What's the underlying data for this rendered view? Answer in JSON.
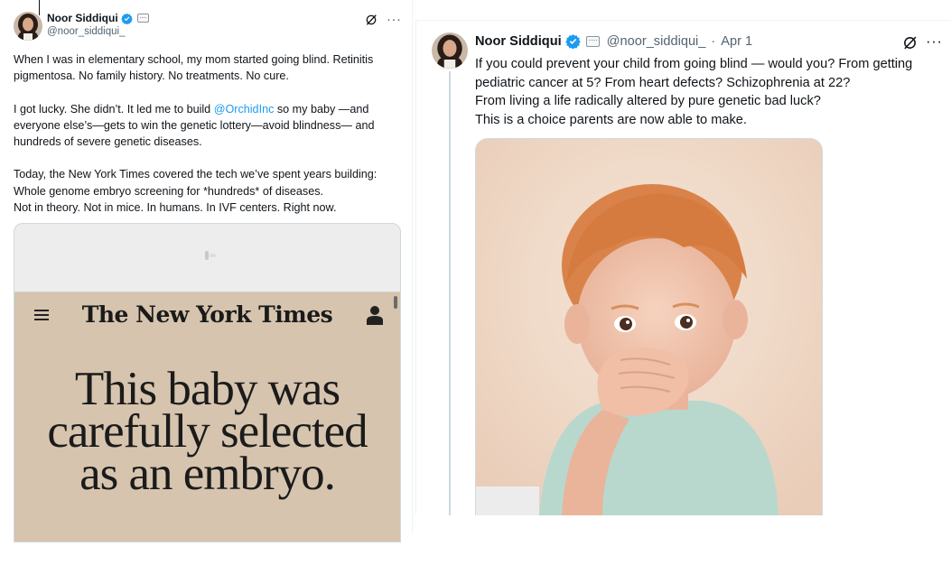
{
  "left_tweet": {
    "author_name": "Noor Siddiqui",
    "handle": "@noor_siddiqui_",
    "paragraphs": [
      [
        "When I was in elementary school, my mom started going blind. Retinitis pigmentosa. No family history. No treatments. No cure."
      ],
      [
        "I got lucky. She didn’t. It led me to build ",
        "@OrchidInc",
        " so my baby —and everyone else’s—gets to win the genetic lottery—avoid blindness— and hundreds of severe genetic diseases."
      ],
      [
        "Today, the New York Times covered the tech we’ve spent years building:",
        "Whole genome embryo screening for *hundreds* of diseases.",
        "Not in theory. Not in mice. In humans. In IVF centers. Right now."
      ]
    ],
    "media": {
      "masthead": "The New York Times",
      "headline_lines": [
        "This baby was",
        "carefully selected",
        "as an embryo."
      ]
    },
    "icons": {
      "verified": "verified-badge-icon",
      "grok": "grok-icon",
      "more": "more-options-icon",
      "menu": "hamburger-menu-icon",
      "user": "account-icon"
    }
  },
  "right_tweet": {
    "author_name": "Noor Siddiqui",
    "handle": "@noor_siddiqui_",
    "separator": "·",
    "date": "Apr 1",
    "lines": [
      "If you could prevent your child from going blind — would you? From getting",
      "pediatric cancer at 5? From heart defects? Schizophrenia at 22?",
      "From living a life radically altered by pure genetic bad luck?",
      "This is a choice parents are now able to make."
    ],
    "media_description_icon": "toddler-photo"
  },
  "colors": {
    "link": "#1d9bf0",
    "secondary_text": "#536471",
    "primary_text": "#0f1419",
    "border": "#cfd9de",
    "nyt_background": "#d6c4ae"
  }
}
